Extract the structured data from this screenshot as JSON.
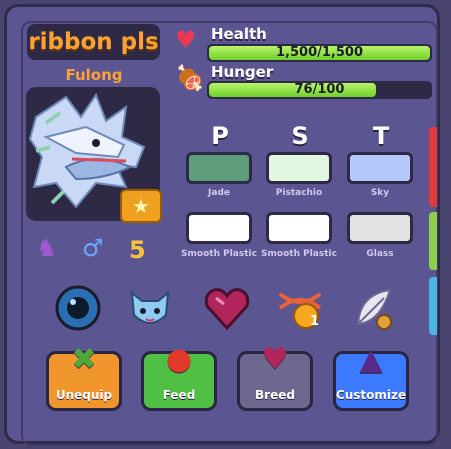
{
  "pet": {
    "name": "ribbon pls",
    "species": "Fulong",
    "age_value": "5"
  },
  "stats": {
    "health_label": "Health",
    "health_value": "1,500/1,500",
    "health_fraction": 1.0,
    "hunger_label": "Hunger",
    "hunger_value": "76/100",
    "hunger_fraction": 0.76
  },
  "pst": {
    "letters": [
      "P",
      "S",
      "T"
    ],
    "colors": [
      {
        "label": "Jade",
        "hex": "#5f9e7c"
      },
      {
        "label": "Pistachio",
        "hex": "#e2f7df"
      },
      {
        "label": "Sky",
        "hex": "#b4c8fb"
      }
    ],
    "materials": [
      {
        "label": "Smooth Plastic",
        "hex": "#ffffff"
      },
      {
        "label": "Smooth Plastic",
        "hex": "#ffffff"
      },
      {
        "label": "Glass",
        "hex": "#e3e3e3"
      }
    ]
  },
  "traits": {
    "icons": [
      "dragon-silhouette-icon",
      "male-symbol-icon"
    ]
  },
  "accessories": [
    "eyeball-icon",
    "blue-pet-face-icon",
    "heart-gem-icon",
    "dna-badge-icon",
    "feather-icon"
  ],
  "accessory_badge": "1",
  "buttons": {
    "unequip": "Unequip",
    "feed": "Feed",
    "breed": "Breed",
    "customize": "Customize"
  },
  "colors": {
    "panel": "#5b5592",
    "accent_orange": "#ffa233",
    "bar_green": "#6fcf2a",
    "button_orange": "#f0962c",
    "button_green": "#4fc043",
    "button_gray": "#6e6890",
    "button_blue": "#3c7bff"
  }
}
